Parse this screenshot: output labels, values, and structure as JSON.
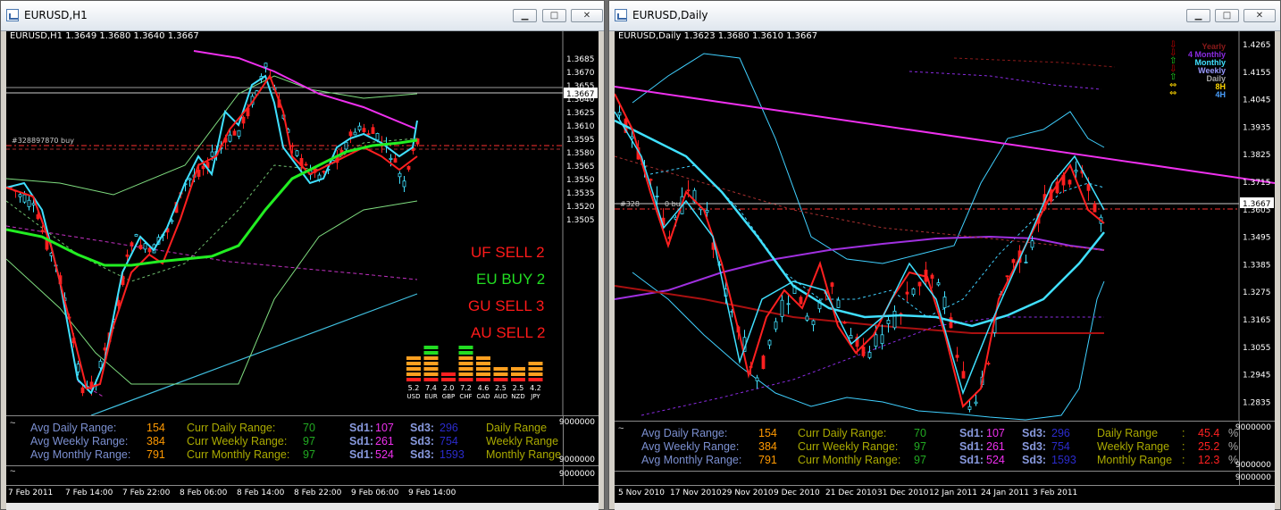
{
  "windows": [
    {
      "title": "EURUSD,H1",
      "symbol_line": "EURUSD,H1  1.3649 1.3680 1.3640 1.3667",
      "order_label": "#328897870 buy",
      "price_scale": [
        "1.3685",
        "1.3670",
        "1.3655",
        "1.3640",
        "1.3625",
        "1.3610",
        "1.3595",
        "1.3580",
        "1.3565",
        "1.3550",
        "1.3535",
        "1.3520",
        "1.3505"
      ],
      "current_price": "1.3667",
      "panel_scale": [
        "9000000",
        "9000000",
        "9000000"
      ],
      "time_labels": [
        "7 Feb 2011",
        "7 Feb 14:00",
        "7 Feb 22:00",
        "8 Feb 06:00",
        "8 Feb 14:00",
        "8 Feb 22:00",
        "9 Feb 06:00",
        "9 Feb 14:00"
      ],
      "signals": [
        {
          "text": "UF SELL 2",
          "color": "#ff1a1a"
        },
        {
          "text": "EU BUY 2",
          "color": "#22dd22"
        },
        {
          "text": "GU SELL 3",
          "color": "#ff1a1a"
        },
        {
          "text": "AU SELL 2",
          "color": "#ff1a1a"
        }
      ],
      "strength": {
        "values": [
          5.2,
          7.4,
          2.0,
          7.2,
          4.6,
          2.5,
          2.5,
          4.2
        ],
        "value_labels": [
          "5.2",
          "7.4",
          "2.0",
          "7.2",
          "4.6",
          "2.5",
          "2.5",
          "4.2"
        ],
        "currencies": [
          "USD",
          "EUR",
          "GBP",
          "CHF",
          "CAD",
          "AUD",
          "NZD",
          "JPY"
        ]
      }
    },
    {
      "title": "EURUSD,Daily",
      "symbol_line": "EURUSD,Daily  1.3623 1.3680 1.3610 1.3667",
      "order_label": "#328",
      "order_label_b": "0 buy",
      "price_scale": [
        "1.4265",
        "1.4155",
        "1.4045",
        "1.3935",
        "1.3825",
        "1.3715",
        "1.3605",
        "1.3495",
        "1.3385",
        "1.3275",
        "1.3165",
        "1.3055",
        "1.2945",
        "1.2835"
      ],
      "current_price": "1.3667",
      "panel_scale": [
        "9000000",
        "9000000",
        "9000000"
      ],
      "time_labels": [
        "5 Nov 2010",
        "17 Nov 2010",
        "29 Nov 2010",
        "9 Dec 2010",
        "21 Dec 2010",
        "31 Dec 2010",
        "12 Jan 2011",
        "24 Jan 2011",
        "3 Feb 2011"
      ],
      "legend": [
        {
          "text": "Yearly",
          "color": "#8b1a1a",
          "arrow": "⇩",
          "arrow_color": "#cc0000"
        },
        {
          "text": "4 Monthly",
          "color": "#8a2be2",
          "arrow": "⇩",
          "arrow_color": "#cc0000"
        },
        {
          "text": "Monthly",
          "color": "#40e0ff",
          "arrow": "⇧",
          "arrow_color": "#22dd22"
        },
        {
          "text": "Weekly",
          "color": "#9a9aff",
          "arrow": "⇩",
          "arrow_color": "#cc0000"
        },
        {
          "text": "Daily",
          "color": "#aaaaaa",
          "arrow": "⇧",
          "arrow_color": "#22dd22"
        },
        {
          "text": "8H",
          "color": "#ffd700",
          "arrow": "⇔",
          "arrow_color": "#ffd700"
        },
        {
          "text": "4H",
          "color": "#4aa0ff",
          "arrow": "⇔",
          "arrow_color": "#ffd700"
        }
      ]
    }
  ],
  "range_panel": {
    "avg_daily_label": "Avg Daily Range:",
    "avg_daily": "154",
    "avg_weekly_label": "Avg Weekly Range:",
    "avg_weekly": "384",
    "avg_monthly_label": "Avg Monthly Range:",
    "avg_monthly": "791",
    "curr_daily_label": "Curr Daily Range:",
    "curr_daily": "70",
    "curr_weekly_label": "Curr Weekly Range:",
    "curr_weekly": "97",
    "curr_monthly_label": "Curr Monthly Range:",
    "curr_monthly": "97",
    "sd1_label": "Sd1:",
    "sd1_daily": "107",
    "sd1_weekly": "261",
    "sd1_monthly": "524",
    "sd3_label": "Sd3:",
    "sd3_daily": "296",
    "sd3_weekly": "754",
    "sd3_monthly": "1593",
    "daily_range_label": "Daily Range",
    "weekly_range_label": "Weekly Range",
    "monthly_range_label": "Monthly Range",
    "colon": ":",
    "pct": "%",
    "daily_pct": "45.4",
    "weekly_pct": "25.2",
    "monthly_pct": "12.3"
  },
  "tilde": "~",
  "buttons": {
    "minimize": "▁",
    "maximize": "□",
    "close": "✕"
  },
  "colors": {
    "up": "#40e0ff",
    "down": "#ff2020",
    "ma_green": "#22ee22",
    "trend_magenta": "#ee30ee",
    "bands": "#7fdd7f"
  }
}
